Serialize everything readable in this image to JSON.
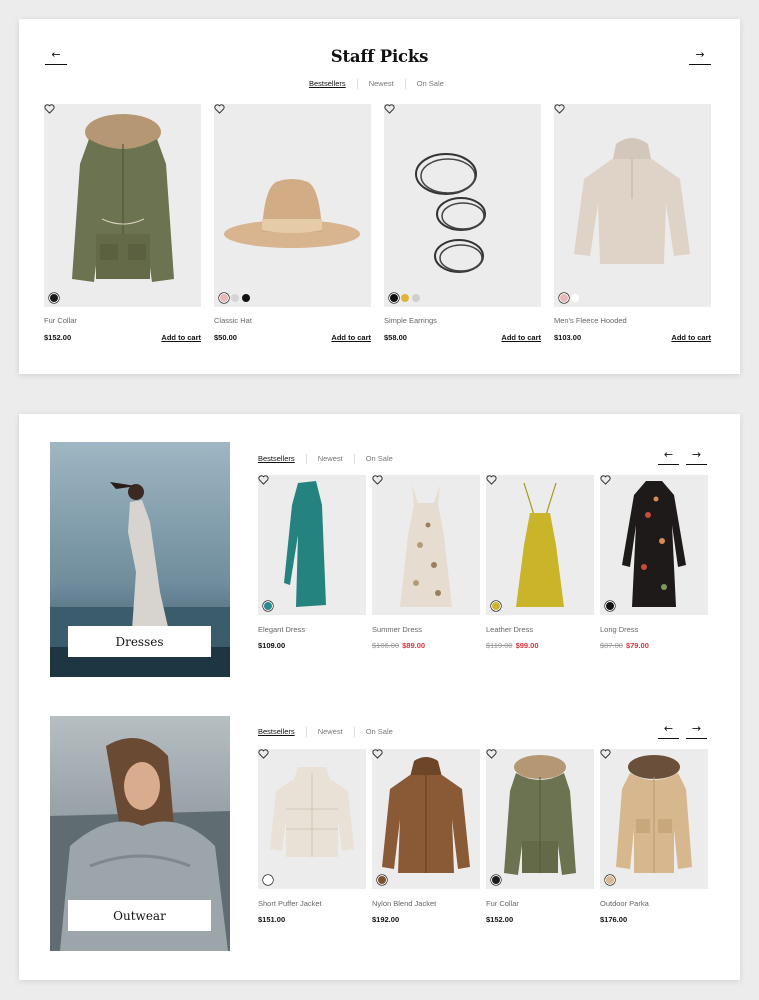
{
  "staff_picks": {
    "title": "Staff Picks",
    "prev_arrow": "←",
    "next_arrow": "→",
    "tabs": [
      {
        "label": "Bestsellers",
        "active": true
      },
      {
        "label": "Newest",
        "active": false
      },
      {
        "label": "On Sale",
        "active": false
      }
    ],
    "add_to_cart_label": "Add to cart",
    "products": [
      {
        "name": "Fur Collar",
        "price": "$152.00",
        "swatches": [
          "#1a1a1a"
        ]
      },
      {
        "name": "Classic Hat",
        "price": "$50.00",
        "swatches": [
          "#e8b9b6",
          "#d5d5d5",
          "#111111"
        ]
      },
      {
        "name": "Simple Earrings",
        "price": "$58.00",
        "swatches": [
          "#111111",
          "#e3b23c",
          "#cfcfcf"
        ]
      },
      {
        "name": "Men's Fleece Hooded",
        "price": "$103.00",
        "swatches": [
          "#e8b9b6",
          "#ffffff"
        ]
      }
    ]
  },
  "dresses": {
    "banner_label": "Dresses",
    "prev_arrow": "←",
    "next_arrow": "→",
    "tabs": [
      {
        "label": "Bestsellers",
        "active": true
      },
      {
        "label": "Newest",
        "active": false
      },
      {
        "label": "On Sale",
        "active": false
      }
    ],
    "products": [
      {
        "name": "Elegant Dress",
        "price": "$109.00",
        "old_price": "",
        "swatches": [
          "#2a8a8c"
        ]
      },
      {
        "name": "Summer Dress",
        "price": "$89.00",
        "old_price": "$106.00",
        "swatches": []
      },
      {
        "name": "Leather Dress",
        "price": "$99.00",
        "old_price": "$119.00",
        "swatches": [
          "#cdb42b"
        ]
      },
      {
        "name": "Long Dress",
        "price": "$79.00",
        "old_price": "$87.00",
        "swatches": [
          "#111111"
        ]
      }
    ]
  },
  "outwear": {
    "banner_label": "Outwear",
    "prev_arrow": "←",
    "next_arrow": "→",
    "tabs": [
      {
        "label": "Bestsellers",
        "active": true
      },
      {
        "label": "Newest",
        "active": false
      },
      {
        "label": "On Sale",
        "active": false
      }
    ],
    "products": [
      {
        "name": "Short Puffer Jacket",
        "price": "$151.00",
        "swatches": [
          "#ffffff"
        ]
      },
      {
        "name": "Nylon Blend Jacket",
        "price": "$192.00",
        "swatches": [
          "#7a5230"
        ]
      },
      {
        "name": "Fur Collar",
        "price": "$152.00",
        "swatches": [
          "#1a1a1a"
        ]
      },
      {
        "name": "Outdoor Parka",
        "price": "$176.00",
        "swatches": [
          "#d9b98f"
        ]
      }
    ]
  },
  "colors": {
    "sale_red": "#d6323c",
    "card_bg": "#ececec",
    "text_dark": "#111111",
    "text_muted": "#666666"
  },
  "icons": {
    "prev": "arrow-left-icon",
    "next": "arrow-right-icon",
    "wishlist": "heart-icon"
  }
}
